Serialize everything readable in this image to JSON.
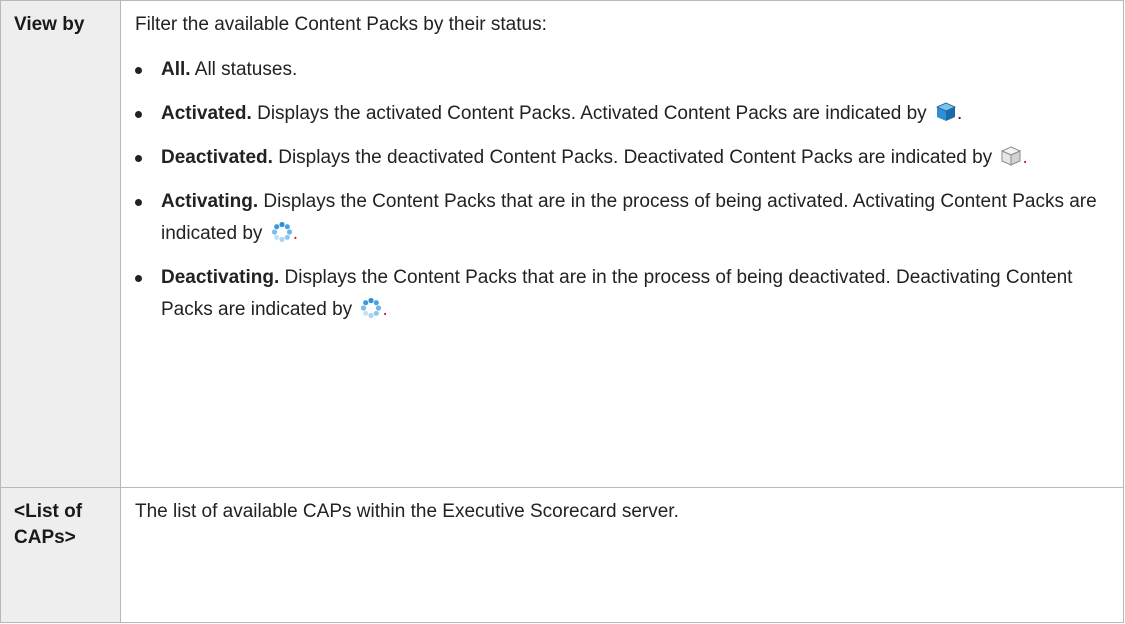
{
  "rows": [
    {
      "term": "View by",
      "intro": "Filter the available Content Packs by their status:",
      "items": [
        {
          "name": "All.",
          "text": " All statuses."
        },
        {
          "name": "Activated.",
          "text": " Displays the activated Content Packs. Activated Content Packs are indicated by ",
          "icon": "activated-content-pack-icon",
          "end": "."
        },
        {
          "name": "Deactivated.",
          "text": " Displays the deactivated Content Packs. Deactivated Content Packs are indicated by ",
          "icon": "deactivated-content-pack-icon",
          "end": "."
        },
        {
          "name": "Activating.",
          "text": " Displays the Content Packs that are in the process of being activated. Activating Content Packs are indicated by ",
          "icon": "activating-spinner-icon",
          "end": "."
        },
        {
          "name": "Deactivating.",
          "text": " Displays the Content Packs that are in the process of being deactivated. Deactivating Content Packs are indicated by ",
          "icon": "deactivating-spinner-icon",
          "end": "."
        }
      ]
    },
    {
      "term": "<List of CAPs>",
      "description": "The list of available CAPs within the Executive Scorecard server."
    }
  ],
  "colors": {
    "term_background": "#eeeeee",
    "border": "#b8b8b8",
    "text": "#222222",
    "link_period": "#d11a1a",
    "activated_icon_blue": "#2f8fd6",
    "deactivated_icon_gray": "#9a9a9a",
    "spinner_blue": "#4aa3e0"
  }
}
